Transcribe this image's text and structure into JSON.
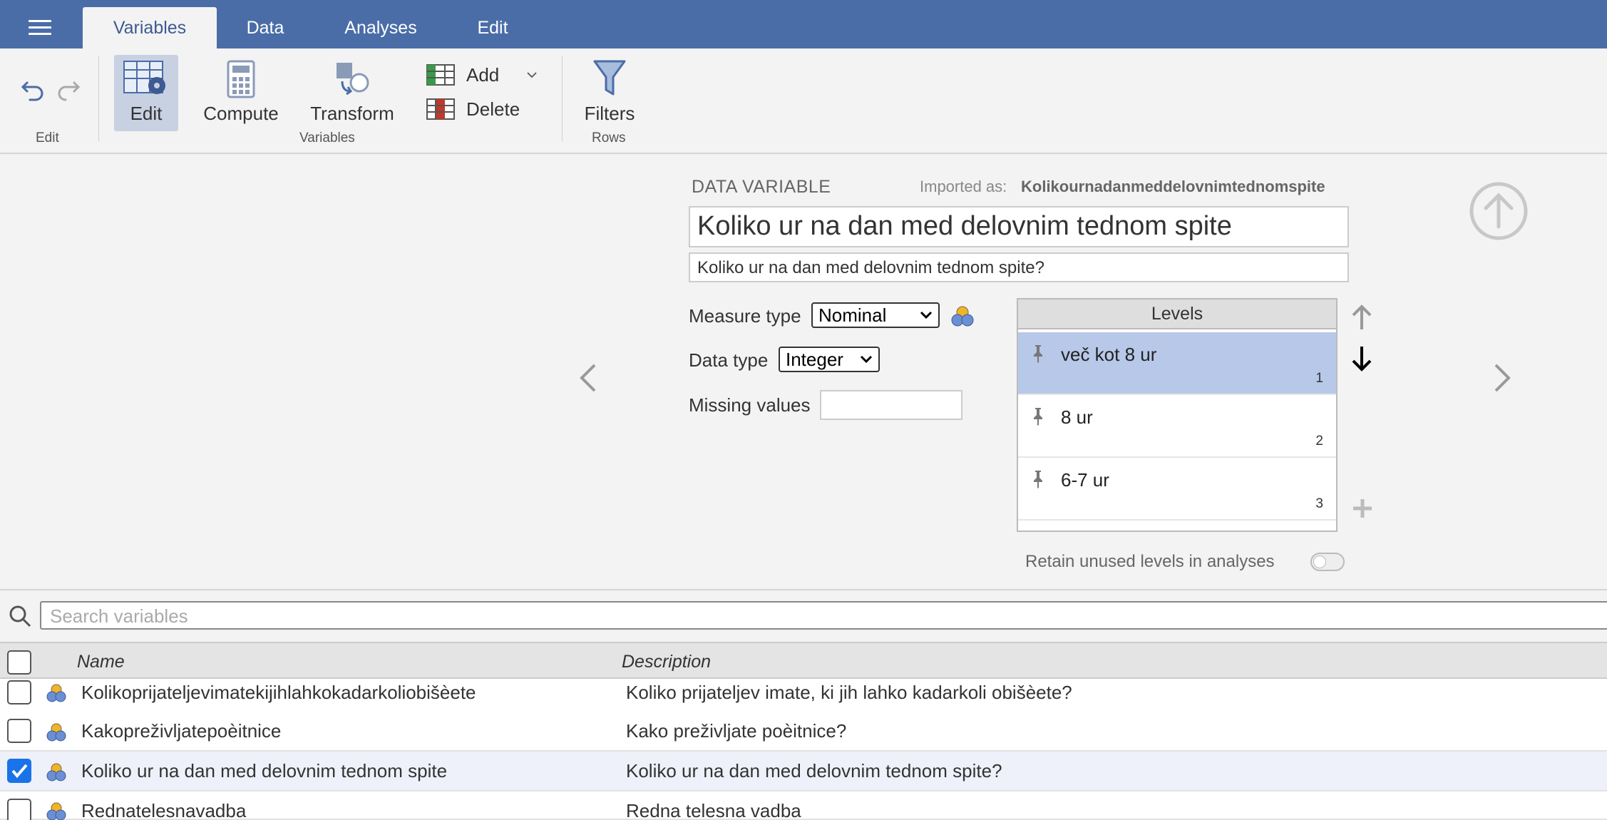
{
  "tabs": [
    {
      "label": "Variables",
      "active": true
    },
    {
      "label": "Data"
    },
    {
      "label": "Analyses"
    },
    {
      "label": "Edit"
    }
  ],
  "ribbon": {
    "edit_group_label": "Edit",
    "edit_btn": "Edit",
    "compute_btn": "Compute",
    "transform_btn": "Transform",
    "add_btn": "Add",
    "delete_btn": "Delete",
    "variables_group_label": "Variables",
    "filters_btn": "Filters",
    "rows_group_label": "Rows"
  },
  "variable": {
    "section_title": "DATA VARIABLE",
    "imported_label": "Imported as:",
    "imported_value": "Kolikournadanmeddelovnimtednomspite",
    "name": "Koliko ur na dan med delovnim tednom spite",
    "description": "Koliko ur na dan med delovnim tednom spite?",
    "measure_type_label": "Measure type",
    "measure_type": "Nominal",
    "data_type_label": "Data type",
    "data_type": "Integer",
    "missing_values_label": "Missing values",
    "missing_values": "",
    "levels_header": "Levels",
    "levels": [
      {
        "label": "več kot 8 ur",
        "value": "1",
        "selected": true
      },
      {
        "label": "8 ur",
        "value": "2"
      },
      {
        "label": "6-7 ur",
        "value": "3"
      }
    ],
    "retain_label": "Retain unused levels in analyses",
    "retain_on": false
  },
  "search": {
    "placeholder": "Search variables"
  },
  "list": {
    "name_header": "Name",
    "description_header": "Description",
    "rows": [
      {
        "name": "Kolikoprijateljevimatekijihlahkokadarkoliobišèete",
        "description": "Koliko prijateljev imate, ki jih lahko kadarkoli obišèete?",
        "checked": false
      },
      {
        "name": "Kakopreživljatepoèitnice",
        "description": "Kako preživljate poèitnice?",
        "checked": false
      },
      {
        "name": "Koliko ur na dan med delovnim tednom spite",
        "description": "Koliko ur na dan med delovnim tednom spite?",
        "checked": true
      },
      {
        "name": "Rednatelesnavadba",
        "description": "Redna telesna vadba",
        "checked": false
      }
    ]
  },
  "colors": {
    "accent": "#4a6da7",
    "selected_level": "#b7c8e9",
    "checkbox_on": "#1a73e8"
  }
}
